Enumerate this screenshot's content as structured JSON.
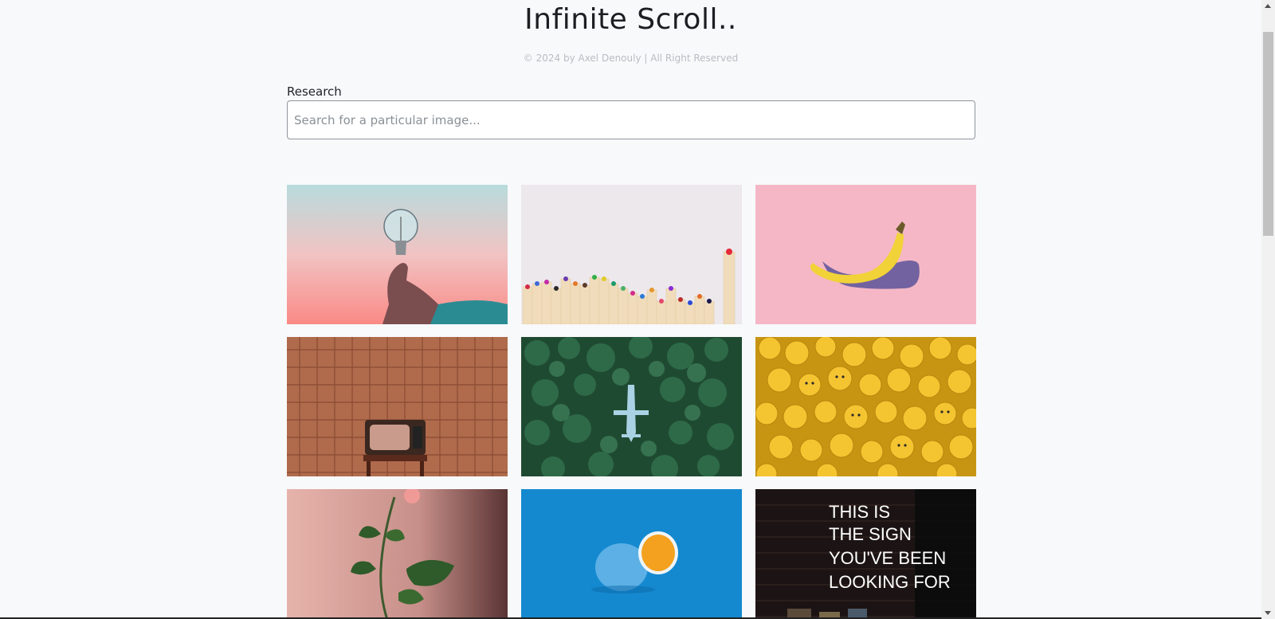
{
  "header": {
    "title": "Infinite Scroll..",
    "copyright": "© 2024 by Axel Denouly | All Right Reserved"
  },
  "search": {
    "label": "Research",
    "placeholder": "Search for a particular image...",
    "value": ""
  },
  "gallery": {
    "images": [
      {
        "name": "lightbulb-in-hand-image"
      },
      {
        "name": "colored-pencils-image"
      },
      {
        "name": "banana-on-pink-image"
      },
      {
        "name": "retro-tv-image"
      },
      {
        "name": "airplane-in-forest-image"
      },
      {
        "name": "lego-heads-image"
      },
      {
        "name": "rose-image"
      },
      {
        "name": "blue-orange-image"
      },
      {
        "name": "neon-sign-image",
        "text_lines": [
          "THIS IS",
          "THE SIGN",
          "YOU'VE BEEN",
          "LOOKING FOR"
        ]
      }
    ]
  },
  "colors": {
    "background": "#f8f9fb",
    "title": "#1c1e22",
    "copyright": "#b8bdc3",
    "input_border": "#8f959b"
  }
}
